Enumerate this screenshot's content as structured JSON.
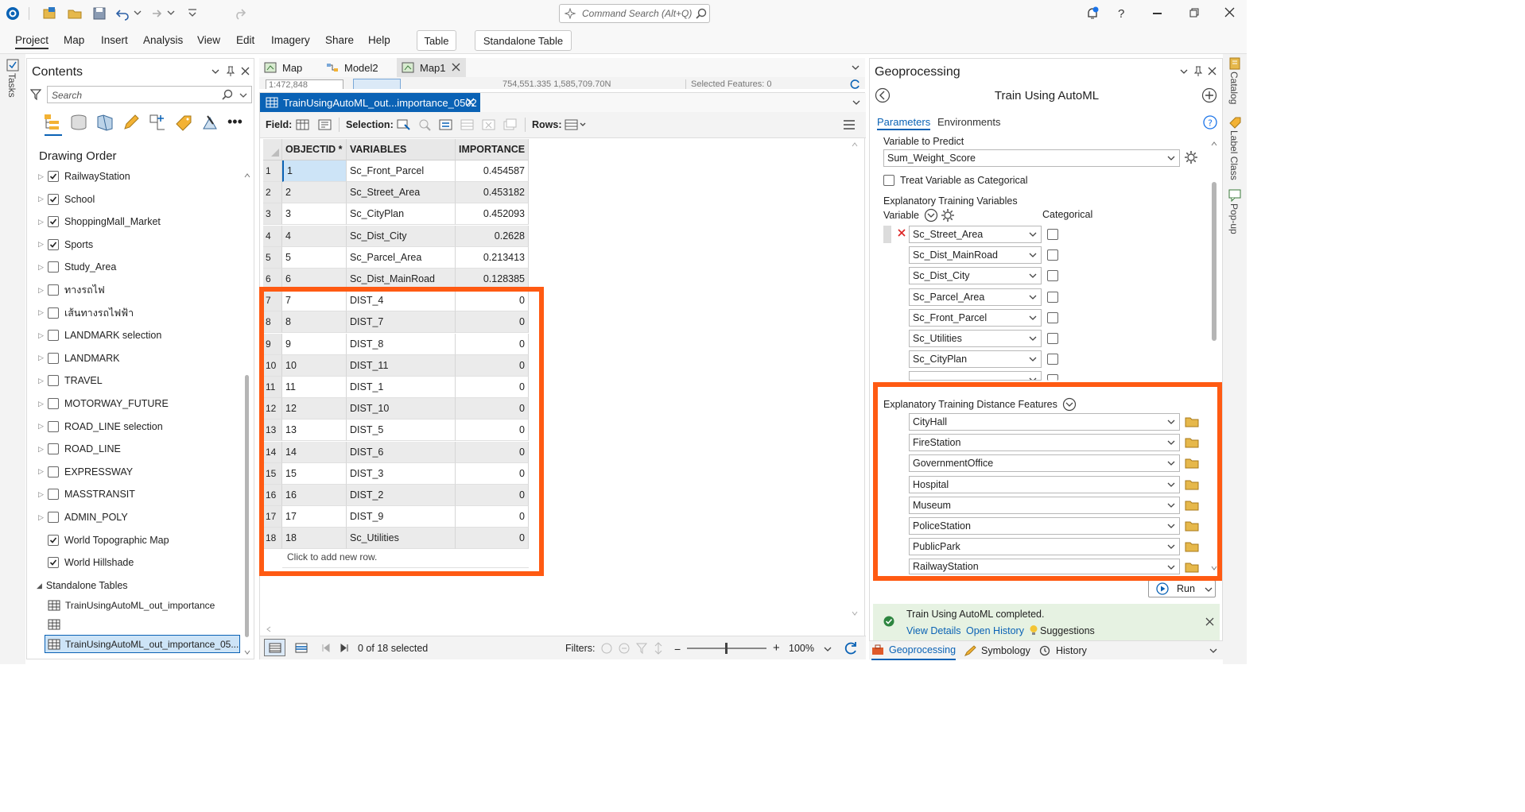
{
  "qat": {
    "search_placeholder": "Command Search (Alt+Q)"
  },
  "menu": {
    "items": [
      "Project",
      "Map",
      "Insert",
      "Analysis",
      "View",
      "Edit",
      "Imagery",
      "Share",
      "Help"
    ],
    "contextual_tabs": [
      "Table",
      "Standalone Table"
    ]
  },
  "left_strip": {
    "label": "Tasks"
  },
  "contents": {
    "title": "Contents",
    "search_placeholder": "Search",
    "drawing_order": "Drawing Order",
    "layers": [
      {
        "name": "RailwayStation",
        "checked": true,
        "expand": true
      },
      {
        "name": "School",
        "checked": true,
        "expand": true
      },
      {
        "name": "ShoppingMall_Market",
        "checked": true,
        "expand": true
      },
      {
        "name": "Sports",
        "checked": true,
        "expand": true
      },
      {
        "name": "Study_Area",
        "checked": false,
        "expand": true
      },
      {
        "name": "ทางรถไฟ",
        "checked": false,
        "expand": true
      },
      {
        "name": "เส้นทางรถไฟฟ้า",
        "checked": false,
        "expand": true
      },
      {
        "name": "LANDMARK selection",
        "checked": false,
        "expand": true
      },
      {
        "name": "LANDMARK",
        "checked": false,
        "expand": true
      },
      {
        "name": "TRAVEL",
        "checked": false,
        "expand": true
      },
      {
        "name": "MOTORWAY_FUTURE",
        "checked": false,
        "expand": true
      },
      {
        "name": "ROAD_LINE selection",
        "checked": false,
        "expand": true
      },
      {
        "name": "ROAD_LINE",
        "checked": false,
        "expand": true
      },
      {
        "name": "EXPRESSWAY",
        "checked": false,
        "expand": true
      },
      {
        "name": "MASSTRANSIT",
        "checked": false,
        "expand": true
      },
      {
        "name": "ADMIN_POLY",
        "checked": false,
        "expand": true
      },
      {
        "name": "World Topographic Map",
        "checked": true,
        "expand": false
      },
      {
        "name": "World Hillshade",
        "checked": true,
        "expand": false
      }
    ],
    "standalone_header": "Standalone Tables",
    "tables": [
      "TrainUsingAutoML_out_importance",
      "",
      "TrainUsingAutoML_out_importance_05..."
    ]
  },
  "view_tabs": {
    "tabs": [
      "Map",
      "Model2",
      "Map1"
    ],
    "map_status": "1:472,848",
    "coords": "754,551.335 1,585,709.70N",
    "selected_features": "Selected Features: 0"
  },
  "table": {
    "tab_title": "TrainUsingAutoML_out...importance_0502",
    "toolbar": {
      "field": "Field:",
      "selection": "Selection:",
      "rows": "Rows:"
    },
    "columns": [
      "OBJECTID *",
      "VARIABLES",
      "IMPORTANCE"
    ],
    "rows": [
      {
        "n": "1",
        "id": "1",
        "var": "Sc_Front_Parcel",
        "imp": "0.454587"
      },
      {
        "n": "2",
        "id": "2",
        "var": "Sc_Street_Area",
        "imp": "0.453182"
      },
      {
        "n": "3",
        "id": "3",
        "var": "Sc_CityPlan",
        "imp": "0.452093"
      },
      {
        "n": "4",
        "id": "4",
        "var": "Sc_Dist_City",
        "imp": "0.2628"
      },
      {
        "n": "5",
        "id": "5",
        "var": "Sc_Parcel_Area",
        "imp": "0.213413"
      },
      {
        "n": "6",
        "id": "6",
        "var": "Sc_Dist_MainRoad",
        "imp": "0.128385"
      },
      {
        "n": "7",
        "id": "7",
        "var": "DIST_4",
        "imp": "0"
      },
      {
        "n": "8",
        "id": "8",
        "var": "DIST_7",
        "imp": "0"
      },
      {
        "n": "9",
        "id": "9",
        "var": "DIST_8",
        "imp": "0"
      },
      {
        "n": "10",
        "id": "10",
        "var": "DIST_11",
        "imp": "0"
      },
      {
        "n": "11",
        "id": "11",
        "var": "DIST_1",
        "imp": "0"
      },
      {
        "n": "12",
        "id": "12",
        "var": "DIST_10",
        "imp": "0"
      },
      {
        "n": "13",
        "id": "13",
        "var": "DIST_5",
        "imp": "0"
      },
      {
        "n": "14",
        "id": "14",
        "var": "DIST_6",
        "imp": "0"
      },
      {
        "n": "15",
        "id": "15",
        "var": "DIST_3",
        "imp": "0"
      },
      {
        "n": "16",
        "id": "16",
        "var": "DIST_2",
        "imp": "0"
      },
      {
        "n": "17",
        "id": "17",
        "var": "DIST_9",
        "imp": "0"
      },
      {
        "n": "18",
        "id": "18",
        "var": "Sc_Utilities",
        "imp": "0"
      }
    ],
    "add_row": "Click to add new row.",
    "status": {
      "selected": "0 of 18 selected",
      "filters": "Filters:",
      "zoom": "100%"
    }
  },
  "gp": {
    "title": "Geoprocessing",
    "tool_title": "Train Using AutoML",
    "tabs": [
      "Parameters",
      "Environments"
    ],
    "var_predict_label": "Variable to Predict",
    "var_predict_value": "Sum_Weight_Score",
    "treat_categorical": "Treat Variable as Categorical",
    "expl_vars_label": "Explanatory Training Variables",
    "variable_col": "Variable",
    "categorical_col": "Categorical",
    "variables": [
      "Sc_Street_Area",
      "Sc_Dist_MainRoad",
      "Sc_Dist_City",
      "Sc_Parcel_Area",
      "Sc_Front_Parcel",
      "Sc_Utilities",
      "Sc_CityPlan",
      ""
    ],
    "dist_label": "Explanatory Training Distance Features",
    "dist_features": [
      "CityHall",
      "FireStation",
      "GovernmentOffice",
      "Hospital",
      "Museum",
      "PoliceStation",
      "PublicPark",
      "RailwayStation"
    ],
    "run": "Run",
    "completed": "Train Using AutoML completed.",
    "links": [
      "View Details",
      "Open History"
    ],
    "suggestions": "Suggestions",
    "bottom_tabs": [
      "Geoprocessing",
      "Symbology",
      "History"
    ]
  },
  "right_strip": {
    "labels": [
      "Catalog",
      "Label Class",
      "Pop-up"
    ]
  },
  "colors": {
    "accent": "#0a62b5",
    "highlight": "#ff5a12",
    "success_bg": "#e6f2e2"
  }
}
